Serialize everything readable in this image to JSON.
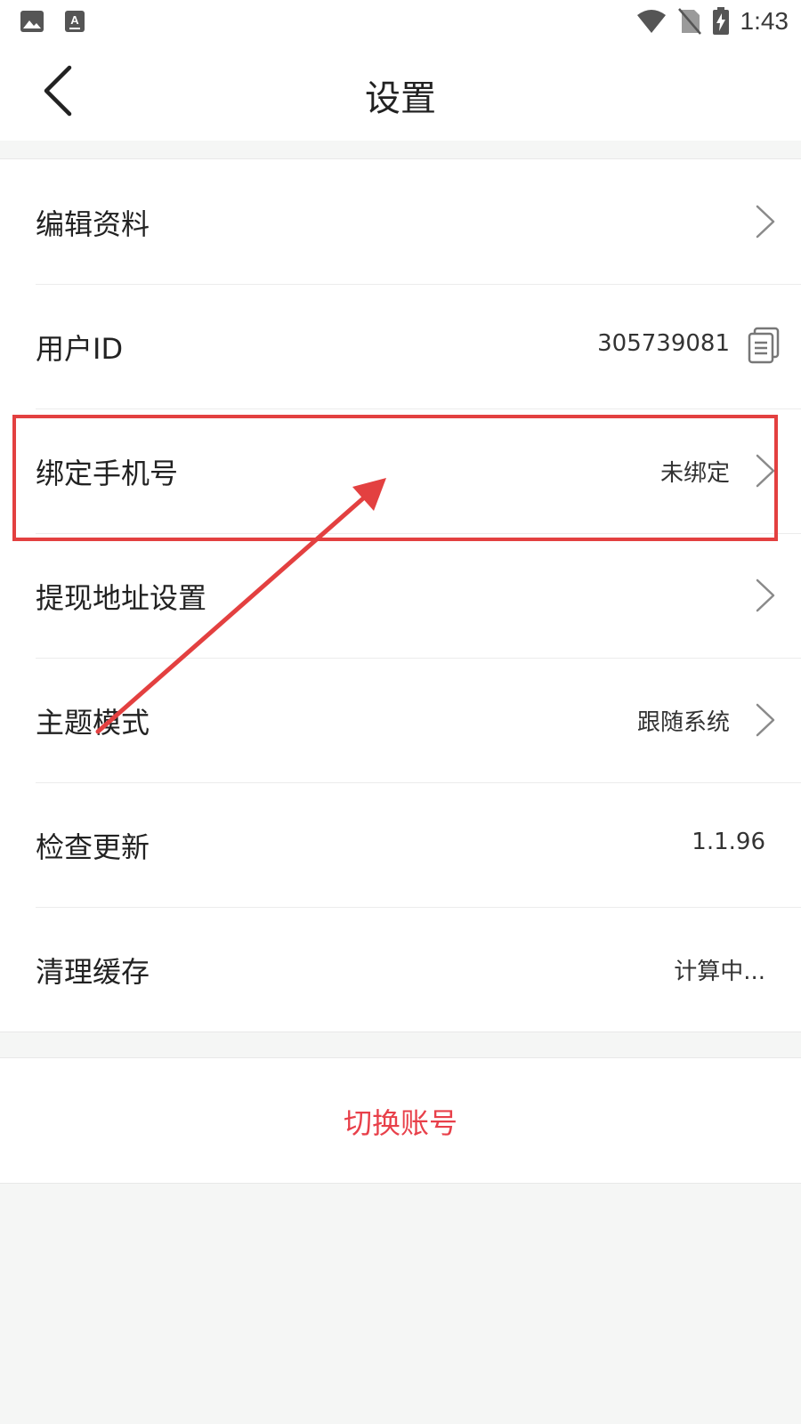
{
  "status_bar": {
    "time": "1:43",
    "icons": [
      "image-icon",
      "keyboard-a-icon",
      "wifi-icon",
      "no-sim-icon",
      "battery-charging-icon"
    ]
  },
  "nav": {
    "title": "设置",
    "back_icon": "chevron-left-icon"
  },
  "settings": {
    "edit_profile": {
      "label": "编辑资料"
    },
    "user_id": {
      "label": "用户ID",
      "value": "305739081"
    },
    "bind_phone": {
      "label": "绑定手机号",
      "value": "未绑定"
    },
    "withdraw_address": {
      "label": "提现地址设置"
    },
    "theme_mode": {
      "label": "主题模式",
      "value": "跟随系统"
    },
    "check_update": {
      "label": "检查更新",
      "value": "1.1.96"
    },
    "clear_cache": {
      "label": "清理缓存",
      "value": "计算中..."
    }
  },
  "switch_account": {
    "label": "切换账号"
  },
  "colors": {
    "accent_red": "#e8404a",
    "annotation_red": "#e34040",
    "background": "#f5f6f5"
  }
}
